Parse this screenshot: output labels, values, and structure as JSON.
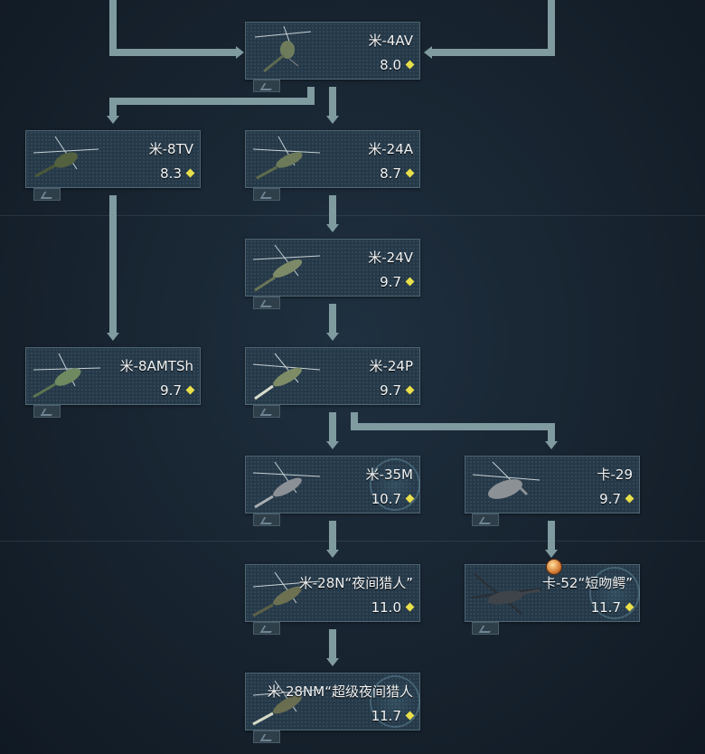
{
  "tree": {
    "nodes": [
      {
        "id": "mi4av",
        "name": "米-4AV",
        "br": "8.0",
        "icon": "helicopter-icon",
        "premium": false
      },
      {
        "id": "mi8tv",
        "name": "米-8TV",
        "br": "8.3",
        "icon": "helicopter-icon",
        "premium": false
      },
      {
        "id": "mi24a",
        "name": "米-24A",
        "br": "8.7",
        "icon": "helicopter-icon",
        "premium": false
      },
      {
        "id": "mi24v",
        "name": "米-24V",
        "br": "9.7",
        "icon": "helicopter-icon",
        "premium": false
      },
      {
        "id": "mi8amtsh",
        "name": "米-8AMTSh",
        "br": "9.7",
        "icon": "helicopter-icon",
        "premium": false
      },
      {
        "id": "mi24p",
        "name": "米-24P",
        "br": "9.7",
        "icon": "helicopter-icon",
        "premium": false
      },
      {
        "id": "mi35m",
        "name": "米-35M",
        "br": "10.7",
        "icon": "helicopter-icon",
        "premium": true
      },
      {
        "id": "ka29",
        "name": "卡-29",
        "br": "9.7",
        "icon": "helicopter-icon",
        "premium": false
      },
      {
        "id": "mi28n",
        "name": "米-28N“夜间猎人”",
        "br": "11.0",
        "icon": "helicopter-icon",
        "premium": false
      },
      {
        "id": "ka52",
        "name": "卡-52“短吻鳄”",
        "br": "11.7",
        "icon": "helicopter-icon",
        "premium": true
      },
      {
        "id": "mi28nm",
        "name": "米-28NM“超级夜间猎人",
        "br": "11.7",
        "icon": "helicopter-icon",
        "premium": true
      }
    ]
  },
  "colors": {
    "background": "#17232f",
    "card": "#253949",
    "card_border": "#4f6674",
    "arrow": "#7f9ba0",
    "br_diamond": "#e8df4a",
    "text": "#f2f4f5"
  }
}
